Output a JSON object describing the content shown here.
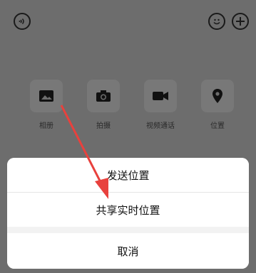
{
  "topbar": {
    "left_icon": "voice-icon",
    "right_icons": [
      "emoji-icon",
      "plus-icon"
    ]
  },
  "panel": {
    "items": [
      {
        "icon": "photo-icon",
        "label": "相册"
      },
      {
        "icon": "camera-icon",
        "label": "拍摄"
      },
      {
        "icon": "video-call-icon",
        "label": "视频通话"
      },
      {
        "icon": "location-icon",
        "label": "位置"
      }
    ]
  },
  "sheet": {
    "send_location": "发送位置",
    "share_live_location": "共享实时位置",
    "cancel": "取消"
  },
  "colors": {
    "overlay": "#6d6d6d",
    "sheet_bg": "#ffffff",
    "arrow": "#e8413d"
  }
}
